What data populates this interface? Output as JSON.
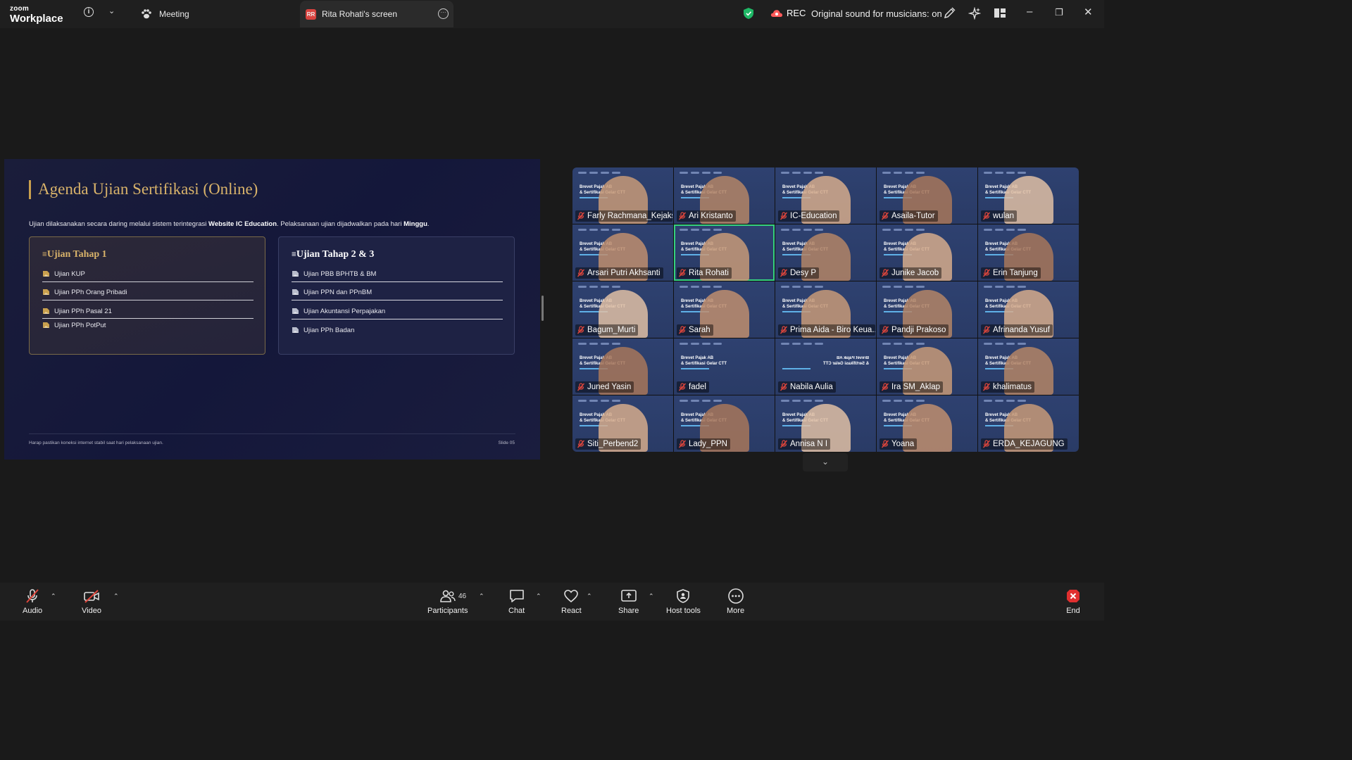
{
  "topbar": {
    "logo_small": "zoom",
    "logo_big": "Workplace",
    "meeting_tab_label": "Meeting",
    "screen_tab_badge": "RR",
    "screen_tab_label": "Rita Rohati's screen",
    "rec_label": "REC",
    "original_sound": "Original sound for musicians: on"
  },
  "slide": {
    "title": "Agenda Ujian Sertifikasi (Online)",
    "desc_part1": "Ujian dilaksanakan secara daring melalui sistem terintegrasi ",
    "desc_bold1": "Website IC Education",
    "desc_part2": ". Pelaksanaan ujian dijadwalkan pada hari ",
    "desc_bold2": "Minggu",
    "desc_part3": ".",
    "card1": {
      "title": "Ujian Tahap 1",
      "items": [
        "Ujian KUP",
        "Ujian PPh Orang Pribadi",
        "Ujian PPh Pasal 21",
        "Ujian PPh PotPut"
      ]
    },
    "card2": {
      "title": "Ujian Tahap 2 & 3",
      "items": [
        "Ujian PBB BPHTB &  BM",
        "Ujian PPN dan PPnBM",
        "Ujian Akuntansi Perpajakan",
        "Ujian PPh Badan"
      ]
    },
    "footer_left": "Harap pastikan koneksi internet stabil saat hari pelaksanaan ujian.",
    "footer_right": "Slide 05"
  },
  "gallery": {
    "slide_title_line1": "Brevet Pajak AB",
    "slide_title_line2": "& Sertifikasi Gelar CTT",
    "mirrored_line1": "Brevet Pajak AB",
    "mirrored_line2": "& Sertifikasi Gelar CTT",
    "participants": [
      "Farly Rachmana_Kejaks...",
      "Ari Kristanto",
      "IC-Education",
      "Asaila-Tutor",
      "wulan",
      "Arsari Putri Akhsanti",
      "Rita Rohati",
      "Desy P",
      "Junike Jacob",
      "Erin Tanjung",
      "Bagum_Murti",
      "Sarah",
      "Prima Aida - Biro Keua...",
      "Pandji Prakoso",
      "Afrinanda Yusuf",
      "Juned Yasin",
      "fadel",
      "Nabila Aulia",
      "Ira SM_Aklap",
      "khalimatus",
      "Siti_Perbend2",
      "Lady_PPN",
      "Annisa N I",
      "Yoana",
      "ERDA_KEJAGUNG"
    ]
  },
  "toolbar": {
    "audio": "Audio",
    "video": "Video",
    "participants": "Participants",
    "participants_count": "46",
    "chat": "Chat",
    "react": "React",
    "share": "Share",
    "host_tools": "Host tools",
    "more": "More",
    "end": "End"
  },
  "colors": {
    "accent_gold": "#d9b36a",
    "active_speaker": "#35d07f",
    "end_red": "#e02f2f",
    "muted_red": "#e0463c"
  }
}
